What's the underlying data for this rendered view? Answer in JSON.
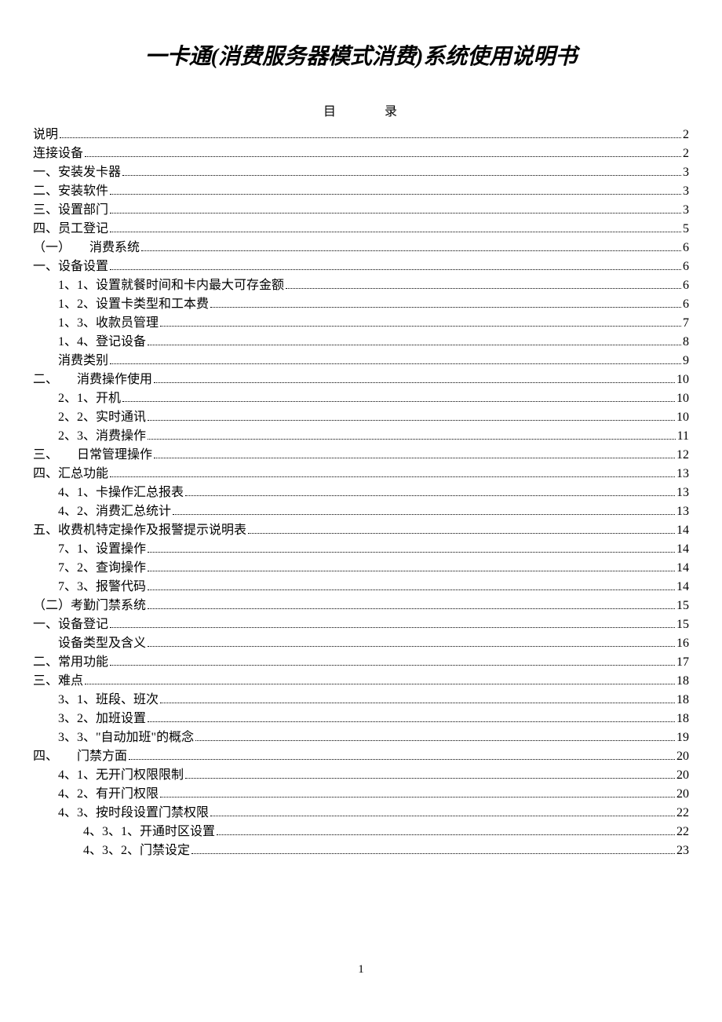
{
  "title": "一卡通(消费服务器模式消费)系统使用说明书",
  "toc_header": "目录",
  "page_number": "1",
  "toc": [
    {
      "label": "说明",
      "page": "2",
      "indent": 0
    },
    {
      "label": "连接设备",
      "page": "2",
      "indent": 0
    },
    {
      "label": "一、安装发卡器",
      "page": "3",
      "indent": 0
    },
    {
      "label": "二、安装软件",
      "page": "3",
      "indent": 0
    },
    {
      "label": "三、设置部门",
      "page": "3",
      "indent": 0
    },
    {
      "label": "四、员工登记",
      "page": "5",
      "indent": 0
    },
    {
      "label": "（一）　　消费系统",
      "page": "6",
      "indent": 0
    },
    {
      "label": "一、设备设置",
      "page": "6",
      "indent": 0
    },
    {
      "label": "1、1、设置就餐时间和卡内最大可存金额",
      "page": "6",
      "indent": 1
    },
    {
      "label": "1、2、设置卡类型和工本费",
      "page": "6",
      "indent": 1
    },
    {
      "label": "1、3、收款员管理",
      "page": "7",
      "indent": 1
    },
    {
      "label": "1、4、登记设备",
      "page": "8",
      "indent": 1
    },
    {
      "label": "消费类别",
      "page": "9",
      "indent": 1
    },
    {
      "label": "二、　　消费操作使用",
      "page": "10",
      "indent": 0
    },
    {
      "label": "2、1、开机",
      "page": "10",
      "indent": 1
    },
    {
      "label": "2、2、实时通讯",
      "page": "10",
      "indent": 1
    },
    {
      "label": "2、3、消费操作",
      "page": "11",
      "indent": 1
    },
    {
      "label": "三、　　日常管理操作",
      "page": "12",
      "indent": 0
    },
    {
      "label": "四、汇总功能",
      "page": "13",
      "indent": 0
    },
    {
      "label": "4、1、卡操作汇总报表",
      "page": "13",
      "indent": 1
    },
    {
      "label": "4、2、消费汇总统计",
      "page": "13",
      "indent": 1
    },
    {
      "label": "五、收费机特定操作及报警提示说明表",
      "page": "14",
      "indent": 0
    },
    {
      "label": "7、1、设置操作",
      "page": "14",
      "indent": 1
    },
    {
      "label": "7、2、查询操作",
      "page": "14",
      "indent": 1
    },
    {
      "label": "7、3、报警代码",
      "page": "14",
      "indent": 1
    },
    {
      "label": "（二）考勤门禁系统",
      "page": "15",
      "indent": 0
    },
    {
      "label": "一、设备登记",
      "page": "15",
      "indent": 0
    },
    {
      "label": "设备类型及含义",
      "page": "16",
      "indent": 1
    },
    {
      "label": "二、常用功能",
      "page": "17",
      "indent": 0
    },
    {
      "label": "三、难点",
      "page": "18",
      "indent": 0
    },
    {
      "label": "3、1、班段、班次",
      "page": "18",
      "indent": 1
    },
    {
      "label": "3、2、加班设置",
      "page": "18",
      "indent": 1
    },
    {
      "label": "3、3、\"自动加班\"的概念",
      "page": "19",
      "indent": 1
    },
    {
      "label": "四、　　门禁方面",
      "page": "20",
      "indent": 0
    },
    {
      "label": "4、1、无开门权限限制",
      "page": "20",
      "indent": 1
    },
    {
      "label": "4、2、有开门权限",
      "page": "20",
      "indent": 1
    },
    {
      "label": "4、3、按时段设置门禁权限",
      "page": "22",
      "indent": 1
    },
    {
      "label": "4、3、1、开通时区设置",
      "page": "22",
      "indent": 2
    },
    {
      "label": "4、3、2、门禁设定",
      "page": "23",
      "indent": 2
    }
  ]
}
